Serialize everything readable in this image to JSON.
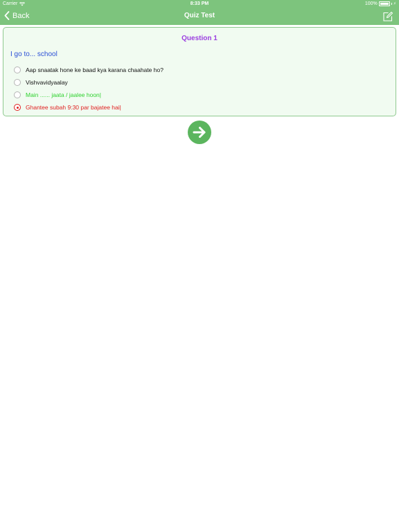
{
  "status_bar": {
    "carrier": "Carrier",
    "time": "8:33 PM",
    "battery": "100%",
    "battery_level": 1.0
  },
  "nav": {
    "back_label": "Back",
    "title": "Quiz Test",
    "back_icon": "chevron-left-icon",
    "edit_icon": "edit-icon"
  },
  "quiz": {
    "question_number": "Question 1",
    "question_text": "I go to... school",
    "options": [
      {
        "label": "Aap snaatak hone ke baad kya karana chaahate ho?",
        "state": "normal"
      },
      {
        "label": "Vishvavidyaalay",
        "state": "normal"
      },
      {
        "label": "Main ...... jaata / jaalee hoon|",
        "state": "correct"
      },
      {
        "label": "Ghantee subah 9:30 par bajatee hai|",
        "state": "selected-wrong"
      }
    ],
    "next_icon": "arrow-right-icon"
  },
  "colors": {
    "header": "#7dc47d",
    "question_number": "#9b3fe0",
    "question_text": "#2a4fd6",
    "correct": "#2ed12e",
    "wrong": "#e02020",
    "next_button": "#5bb55e"
  }
}
